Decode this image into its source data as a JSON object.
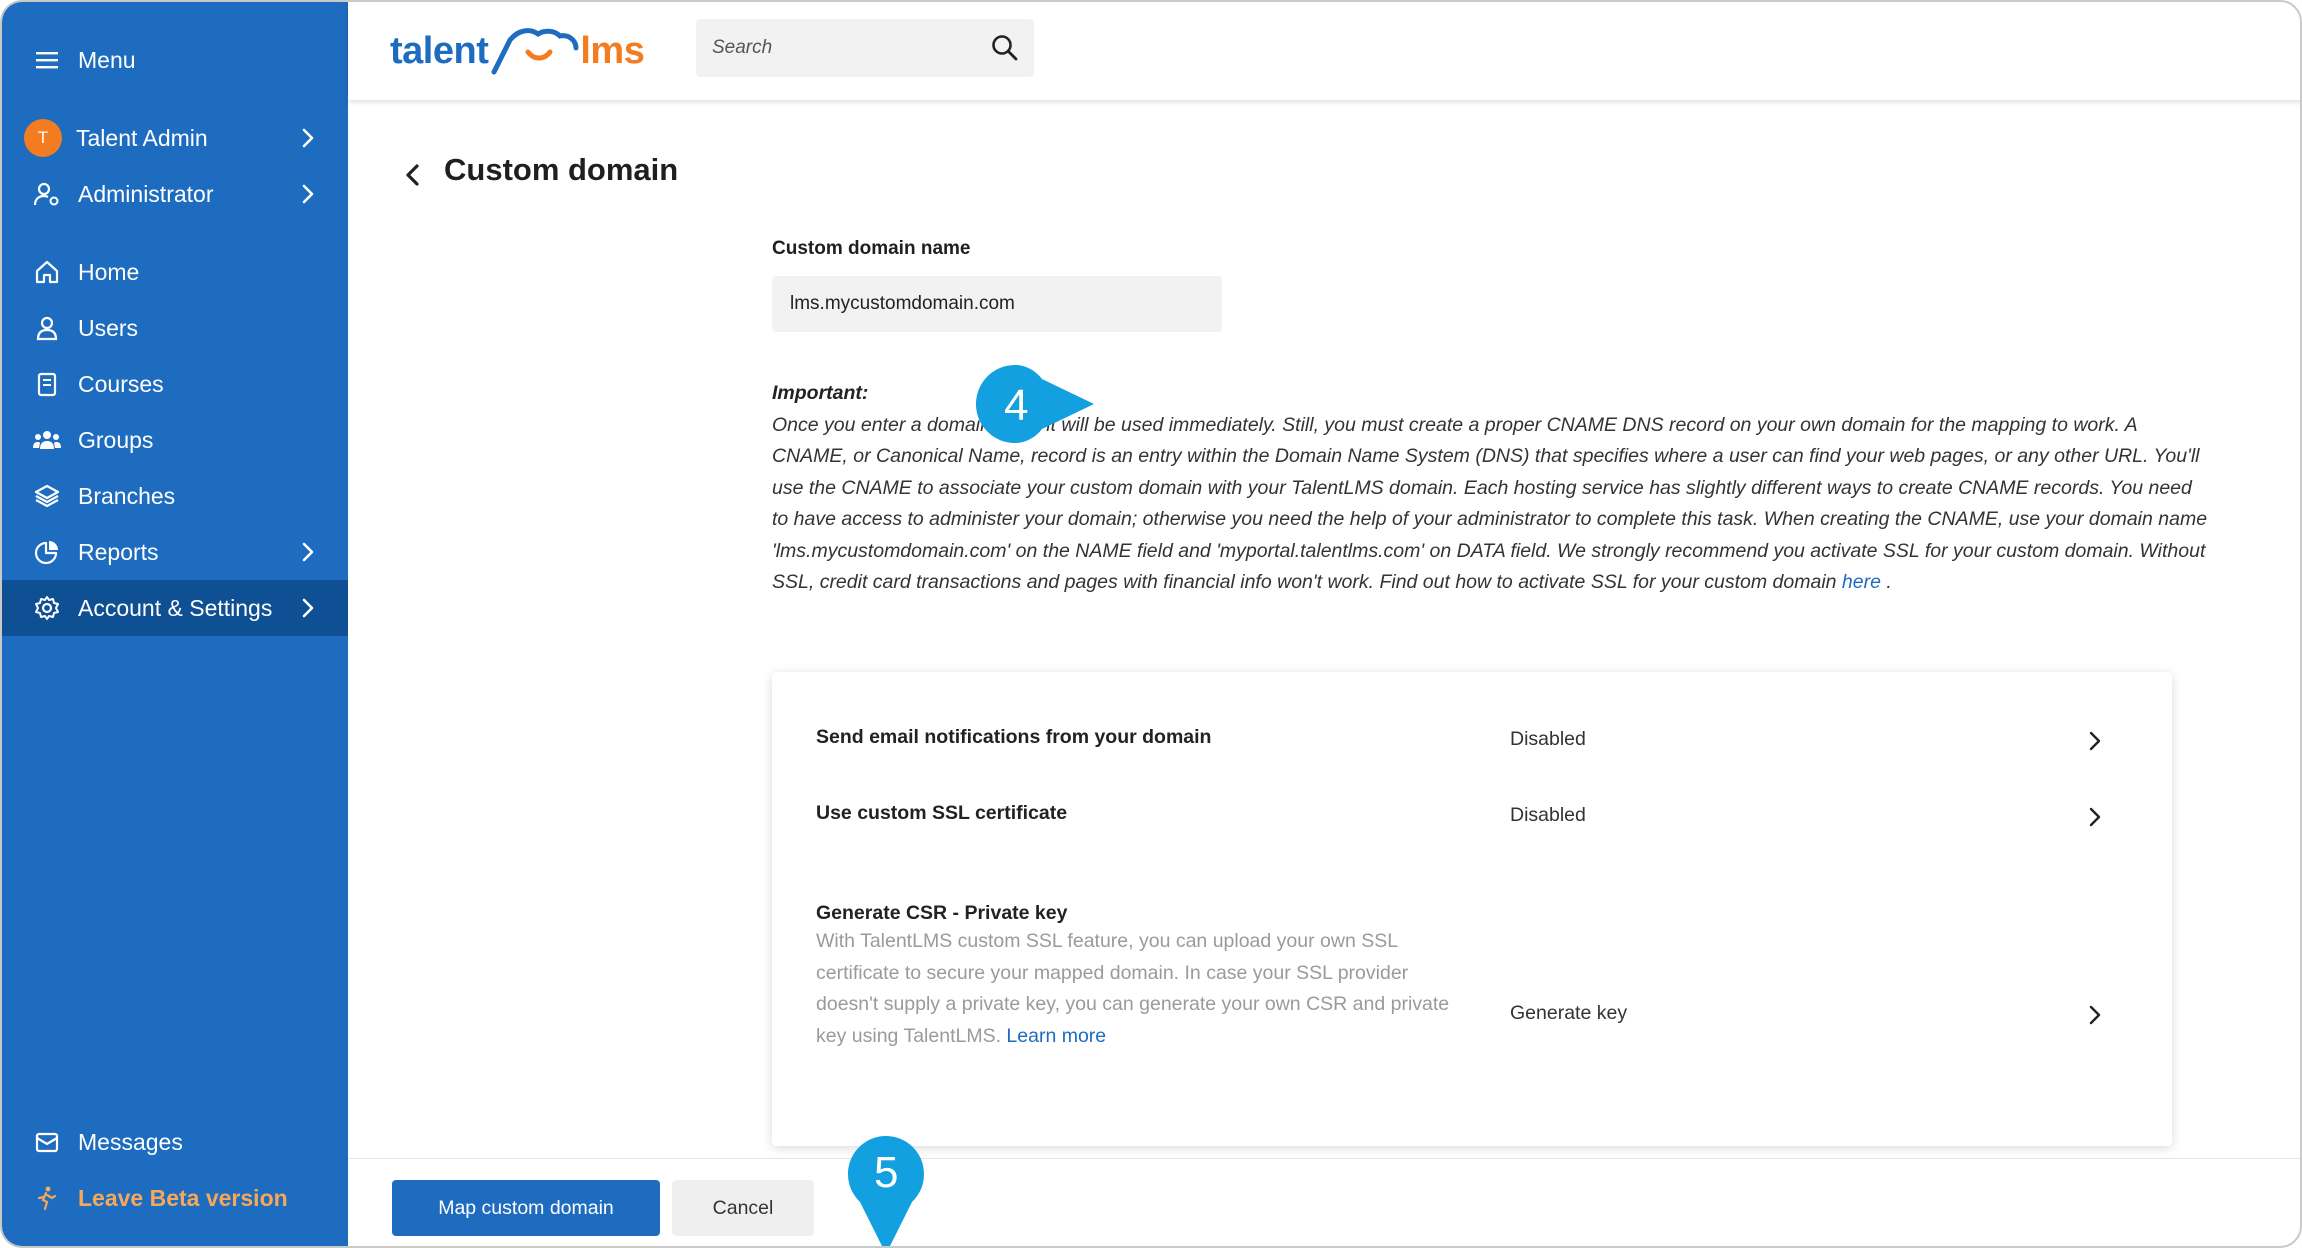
{
  "sidebar": {
    "menu_label": "Menu",
    "profile": {
      "initial": "T",
      "name": "Talent Admin"
    },
    "role": "Administrator",
    "items": [
      {
        "label": "Home",
        "icon": "home-icon"
      },
      {
        "label": "Users",
        "icon": "user-icon"
      },
      {
        "label": "Courses",
        "icon": "book-icon"
      },
      {
        "label": "Groups",
        "icon": "groups-icon"
      },
      {
        "label": "Branches",
        "icon": "layers-icon"
      },
      {
        "label": "Reports",
        "icon": "pie-chart-icon"
      },
      {
        "label": "Account & Settings",
        "icon": "gear-icon"
      }
    ],
    "messages_label": "Messages",
    "leave_beta_label": "Leave Beta version"
  },
  "header": {
    "logo_part1": "talent",
    "logo_part2": "lms",
    "search_placeholder": "Search"
  },
  "page": {
    "title": "Custom domain",
    "field_label": "Custom domain name",
    "field_value": "lms.mycustomdomain.com",
    "important_heading": "Important:",
    "important_text": "Once you enter a domain here, it will be used immediately. Still, you must create a proper CNAME DNS record on your own domain for the mapping to work. A CNAME, or Canonical Name, record is an entry within the Domain Name System (DNS) that specifies where a user can find your web pages, or any other URL. You'll use the CNAME to associate your custom domain with your TalentLMS domain. Each hosting service has slightly different ways to create CNAME records. You need to have access to administer your domain; otherwise you need the help of your administrator to complete this task. When creating the CNAME, use your domain name 'lms.mycustomdomain.com' on the NAME field and 'myportal.talentlms.com' on DATA field. We strongly recommend you activate SSL for your custom domain. Without SSL, credit card transactions and pages with financial info won't work. Find out how to activate SSL for your custom domain",
    "important_link": "here",
    "important_end": " ."
  },
  "settings_rows": [
    {
      "title": "Send email notifications from your domain",
      "value": "Disabled"
    },
    {
      "title": "Use custom SSL certificate",
      "value": "Disabled"
    },
    {
      "title": "Generate CSR - Private key",
      "value": "Generate key",
      "description": "With TalentLMS custom SSL feature, you can upload your own SSL certificate to secure your mapped domain. In case your SSL provider doesn't supply a private key, you can generate your own CSR and private key using TalentLMS.",
      "link": "Learn more"
    }
  ],
  "actions": {
    "primary": "Map custom domain",
    "cancel": "Cancel"
  },
  "callouts": {
    "step4": "4",
    "step5": "5"
  },
  "colors": {
    "sidebar": "#1d6cbf",
    "active": "#0f4f93",
    "accent_orange": "#f47c20",
    "callout": "#12a0e0"
  }
}
